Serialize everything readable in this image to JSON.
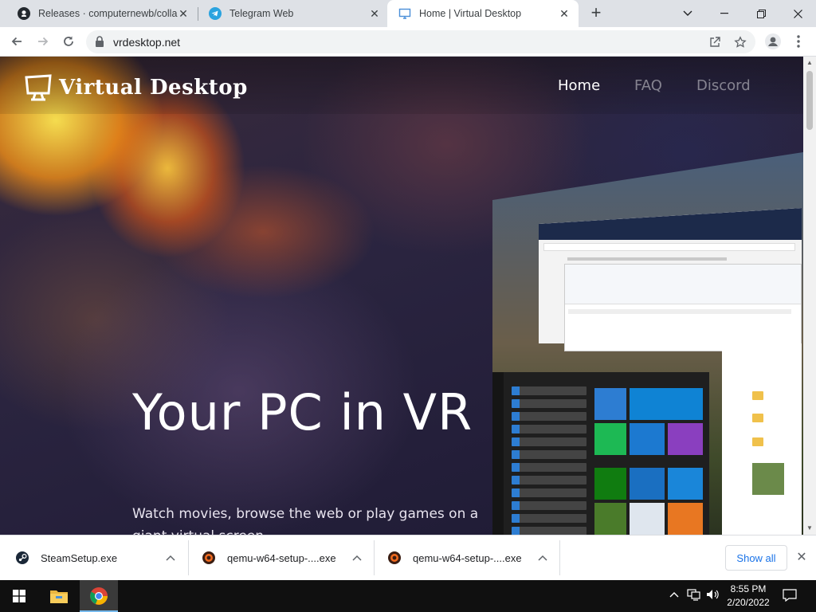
{
  "browser": {
    "tabs": [
      {
        "title": "Releases · computernewb/collab",
        "icon": "github-icon"
      },
      {
        "title": "Telegram Web",
        "icon": "telegram-icon"
      },
      {
        "title": "Home | Virtual Desktop",
        "icon": "monitor-icon"
      }
    ],
    "address": "vrdesktop.net",
    "accent": "#1a73e8"
  },
  "site": {
    "logo_text": "Virtual Desktop",
    "nav": [
      {
        "label": "Home",
        "active": true
      },
      {
        "label": "FAQ",
        "active": false
      },
      {
        "label": "Discord",
        "active": false
      }
    ],
    "hero_title": "Your PC in VR",
    "hero_subtitle": "Watch movies, browse the web or play games on a giant virtual screen"
  },
  "downloads": {
    "items": [
      {
        "name": "SteamSetup.exe",
        "icon": "steam-icon"
      },
      {
        "name": "qemu-w64-setup-....exe",
        "icon": "qemu-icon"
      },
      {
        "name": "qemu-w64-setup-....exe",
        "icon": "qemu-icon"
      }
    ],
    "show_all": "Show all"
  },
  "taskbar": {
    "time": "8:55 PM",
    "date": "2/20/2022"
  }
}
